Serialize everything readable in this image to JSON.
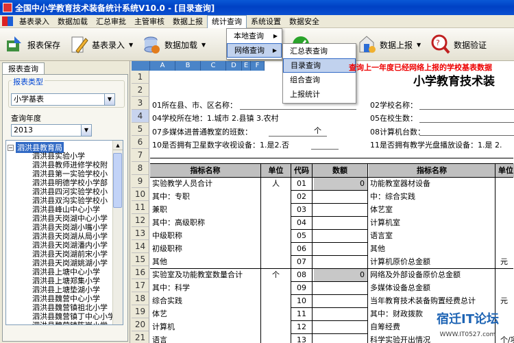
{
  "window": {
    "title": "全国中小学教育技术装备统计系统V10.0   - [目录查询]"
  },
  "menubar": {
    "items": [
      "基表录入",
      "数据加载",
      "汇总审批",
      "主管审核",
      "数据上报",
      "统计查询",
      "系统设置",
      "数据安全"
    ]
  },
  "toolbar": {
    "save": "报表保存",
    "entry": "基表录入",
    "load": "数据加载",
    "upload": "数据上报",
    "verify": "数据验证"
  },
  "stats_menu": {
    "local": "本地查询",
    "network": "网络查询"
  },
  "network_menu": {
    "items": [
      "汇总表查询",
      "目录查询",
      "组合查询",
      "上报统计"
    ],
    "selected": "目录查询"
  },
  "notice": "查询上一年度已经网络上报的学校基表数据",
  "left": {
    "tab": "报表查询",
    "report_type_label": "报表类型",
    "report_type_value": "小学基表",
    "year_label": "查询年度",
    "year_value": "2013",
    "tree_root": "泗洪县教育局",
    "schools": [
      "泗洪县实验小学",
      "泗洪县教师进修学校附",
      "泗洪县第一实验学校小",
      "泗洪县明德学校小学部",
      "泗洪县四河实验学校小",
      "泗洪县双沟实验学校小",
      "泗洪县峰山中心小学",
      "泗洪县天岗湖中心小学",
      "泗洪县天岗湖小嘴小学",
      "泗洪县天岗湖从局小学",
      "泗洪县天岗湖潘内小学",
      "泗洪县天岗湖前宋小学",
      "泗洪县天岗湖姚湖小学",
      "泗洪县上塘中心小学",
      "泗洪县上塘郑集小学",
      "泗洪县上塘垫湖小学",
      "泗洪县魏营中心小学",
      "泗洪县魏营镇祖北小学",
      "泗洪县魏营镇丁中心小学",
      "泗洪县魏营镇陈岗小学"
    ]
  },
  "sheet": {
    "col_headers": [
      "A",
      "B",
      "C",
      "D",
      "E",
      "F"
    ],
    "row_numbers": [
      "1",
      "2",
      "3",
      "4",
      "5",
      "6",
      "7",
      "8",
      "9",
      "10",
      "11",
      "12",
      "13",
      "14",
      "15",
      "16",
      "17",
      "18",
      "19",
      "20",
      "21",
      "22"
    ],
    "title": "小学教育技术装",
    "info": {
      "county": "01所在县、市、区名称：",
      "location": "04学校所在地：1.城市 2.县镇 3.农村",
      "multimedia": "07多媒体进普通教室的班数：",
      "multimedia_unit": "个",
      "satellite": "10是否拥有卫星数字收视设备：1.是2.否",
      "school_name": "02学校名称：",
      "students": "05在校生数：",
      "computers": "08计算机台数：",
      "disc": "11是否拥有教学光盘播放设备：1.是 2."
    },
    "table_header": {
      "name": "指标名称",
      "unit": "单位",
      "code": "代码",
      "value": "数额",
      "name2": "指标名称",
      "unit2": "单位"
    },
    "left_rows": [
      {
        "name": "实验教学人员合计",
        "unit": "人",
        "code": "01",
        "value": "0"
      },
      {
        "name": "  其中：专职",
        "unit": "",
        "code": "02",
        "value": ""
      },
      {
        "name": "        兼职",
        "unit": "",
        "code": "03",
        "value": ""
      },
      {
        "name": "  其中：高级职称",
        "unit": "",
        "code": "04",
        "value": ""
      },
      {
        "name": "        中级职称",
        "unit": "",
        "code": "05",
        "value": ""
      },
      {
        "name": "        初级职称",
        "unit": "",
        "code": "06",
        "value": ""
      },
      {
        "name": "        其他",
        "unit": "",
        "code": "07",
        "value": ""
      },
      {
        "name": "实验室及功能教室数量合计",
        "unit": "个",
        "code": "08",
        "value": "0"
      },
      {
        "name": "  其中：科学",
        "unit": "",
        "code": "09",
        "value": ""
      },
      {
        "name": "        综合实践",
        "unit": "",
        "code": "10",
        "value": ""
      },
      {
        "name": "        体艺",
        "unit": "",
        "code": "11",
        "value": ""
      },
      {
        "name": "        计算机",
        "unit": "",
        "code": "12",
        "value": ""
      },
      {
        "name": "        语言",
        "unit": "",
        "code": "13",
        "value": ""
      }
    ],
    "right_rows": [
      {
        "name": "  功能教室器材设备",
        "unit": ""
      },
      {
        "name": "      中：综合实践",
        "unit": ""
      },
      {
        "name": "            体艺室",
        "unit": ""
      },
      {
        "name": "            计算机室",
        "unit": ""
      },
      {
        "name": "            语言室",
        "unit": ""
      },
      {
        "name": "            其他",
        "unit": ""
      },
      {
        "name": "计算机原价总金额",
        "unit": "元"
      },
      {
        "name": "网络及外部设备原价总金额",
        "unit": ""
      },
      {
        "name": "多媒体设备总金额",
        "unit": ""
      },
      {
        "name": "当年教育技术装备购置经费总计",
        "unit": "元"
      },
      {
        "name": "  其中：财政拨款",
        "unit": ""
      },
      {
        "name": "        自筹经费",
        "unit": ""
      },
      {
        "name": "科学实验开出情况",
        "unit": "个/项"
      }
    ]
  },
  "watermark": {
    "title": "宿迁IT论坛",
    "url": "WWW.IT0527.com"
  }
}
